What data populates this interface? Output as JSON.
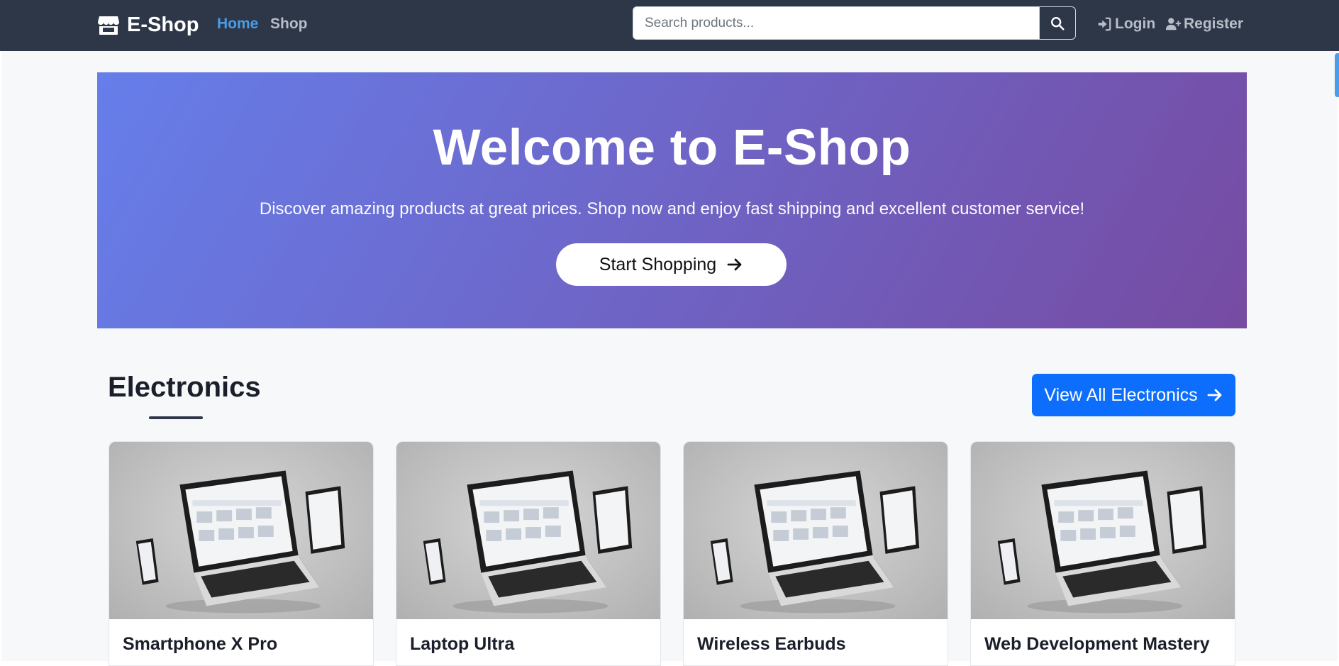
{
  "navbar": {
    "brand": "E-Shop",
    "links": [
      {
        "label": "Home",
        "active": true
      },
      {
        "label": "Shop",
        "active": false
      }
    ],
    "search": {
      "placeholder": "Search products...",
      "value": ""
    },
    "login": "Login",
    "register": "Register"
  },
  "hero": {
    "title": "Welcome to E-Shop",
    "subtitle": "Discover amazing products at great prices. Shop now and enjoy fast shipping and excellent customer service!",
    "cta": "Start Shopping"
  },
  "section": {
    "title": "Electronics",
    "view_all": "View All Electronics"
  },
  "products": [
    {
      "name": "Smartphone X Pro"
    },
    {
      "name": "Laptop Ultra"
    },
    {
      "name": "Wireless Earbuds"
    },
    {
      "name": "Web Development Mastery"
    }
  ],
  "colors": {
    "navbar_bg": "#2d3748",
    "active_link": "#4a9de8",
    "hero_start": "#667eea",
    "hero_end": "#764ba2",
    "primary_button": "#0d6efd"
  },
  "icons": {
    "brand": "store-icon",
    "search": "search-icon",
    "login": "sign-in-icon",
    "register": "user-plus-icon",
    "arrow": "arrow-right-icon"
  }
}
